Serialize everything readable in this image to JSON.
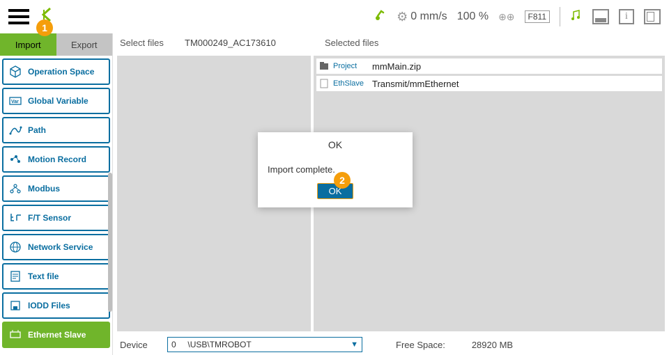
{
  "topbar": {
    "speed": "0 mm/s",
    "percent": "100 %",
    "code": "F811"
  },
  "callouts": {
    "one": "1",
    "two": "2"
  },
  "tabs": {
    "import": "Import",
    "export": "Export"
  },
  "sidebar": {
    "items": [
      {
        "label": "Operation Space"
      },
      {
        "label": "Global Variable"
      },
      {
        "label": "Path"
      },
      {
        "label": "Motion Record"
      },
      {
        "label": "Modbus"
      },
      {
        "label": "F/T Sensor"
      },
      {
        "label": "Network Service"
      },
      {
        "label": "Text file"
      },
      {
        "label": "IODD Files"
      },
      {
        "label": "Ethernet Slave"
      }
    ]
  },
  "files": {
    "select_label": "Select files",
    "folder": "TM000249_AC173610",
    "selected_label": "Selected files",
    "selected": [
      {
        "type": "Project",
        "name": "mmMain.zip"
      },
      {
        "type": "EthSlave",
        "name": "Transmit/mmEthernet"
      }
    ]
  },
  "bottom": {
    "device_label": "Device",
    "device_index": "0",
    "device_path": "\\USB\\TMROBOT",
    "free_space_label": "Free Space:",
    "free_space_value": "28920 MB"
  },
  "modal": {
    "title": "OK",
    "message": "Import complete.",
    "ok_label": "OK"
  }
}
